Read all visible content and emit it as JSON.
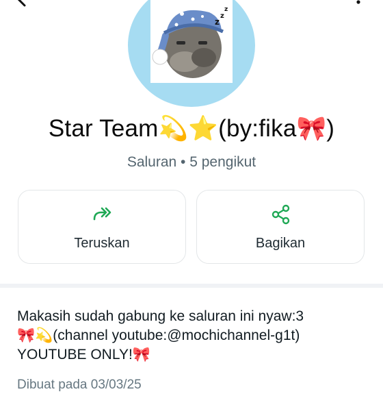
{
  "header": {
    "back_icon": "arrow-back-icon",
    "more_icon": "more-vertical-icon"
  },
  "channel": {
    "name": "Star Team💫⭐(by:fika🎀)",
    "meta": "Saluran • 5 pengikut",
    "avatar_description_icon": "sleeping-cat-avatar"
  },
  "actions": {
    "forward": {
      "label": "Teruskan",
      "icon": "forward-icon",
      "color": "#1fa855"
    },
    "share": {
      "label": "Bagikan",
      "icon": "share-icon",
      "color": "#1fa855"
    }
  },
  "description": {
    "line1": "Makasih sudah gabung ke saluran ini nyaw:3",
    "line2": "🎀💫(channel youtube:@mochichannel-g1t)",
    "line3": "YOUTUBE ONLY!🎀"
  },
  "created": {
    "text": "Dibuat pada 03/03/25"
  },
  "colors": {
    "accent": "#1fa855",
    "avatar_background": "#a6dcf2",
    "secondary_text": "#54656f"
  }
}
